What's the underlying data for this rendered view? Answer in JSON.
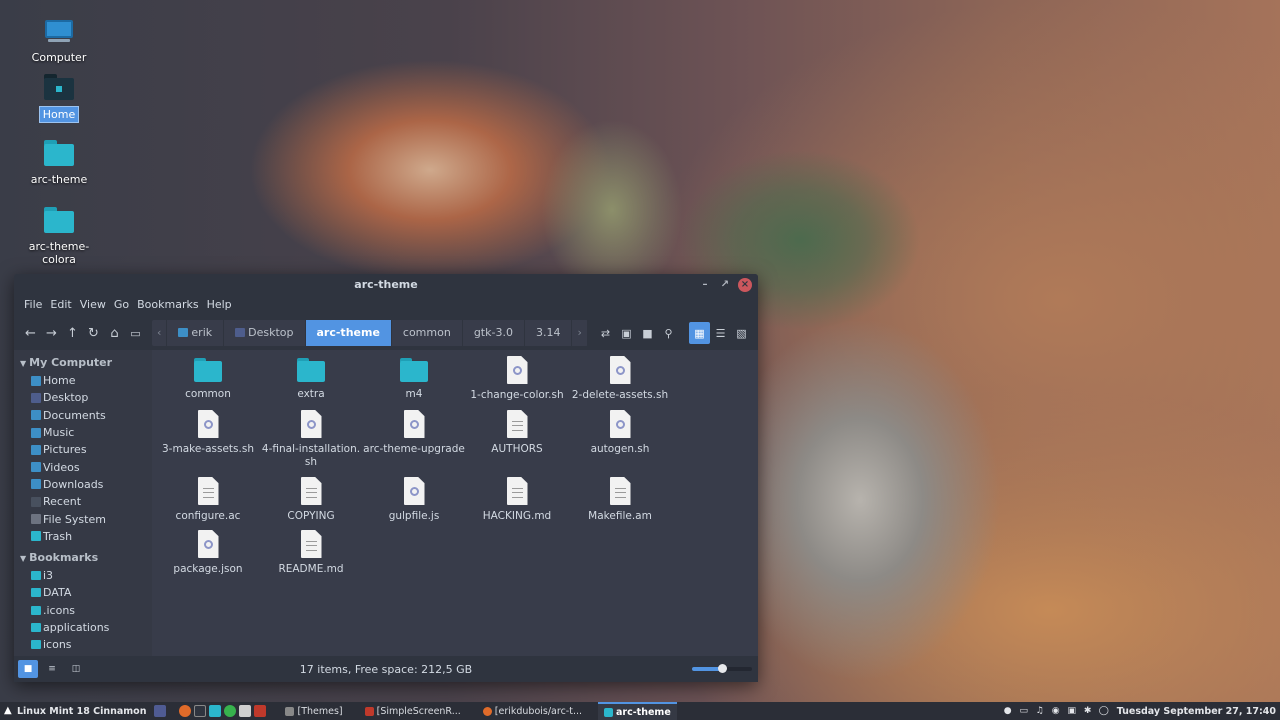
{
  "desktop": {
    "icons": [
      {
        "label": "Computer"
      },
      {
        "label": "Home"
      },
      {
        "label": "arc-theme"
      },
      {
        "label": "arc-theme-colora"
      }
    ]
  },
  "window": {
    "title": "arc-theme",
    "menu": [
      "File",
      "Edit",
      "View",
      "Go",
      "Bookmarks",
      "Help"
    ],
    "breadcrumbs": [
      "erik",
      "Desktop",
      "arc-theme",
      "common",
      "gtk-3.0",
      "3.14"
    ],
    "active_crumb": "arc-theme"
  },
  "sidebar": {
    "my_computer": {
      "title": "My Computer",
      "items": [
        {
          "label": "Home",
          "icon": "home-icon"
        },
        {
          "label": "Desktop",
          "icon": "desktop-icon"
        },
        {
          "label": "Documents",
          "icon": "folder-icon"
        },
        {
          "label": "Music",
          "icon": "music-icon"
        },
        {
          "label": "Pictures",
          "icon": "pictures-icon"
        },
        {
          "label": "Videos",
          "icon": "videos-icon"
        },
        {
          "label": "Downloads",
          "icon": "downloads-icon"
        },
        {
          "label": "Recent",
          "icon": "recent-icon"
        },
        {
          "label": "File System",
          "icon": "filesystem-icon"
        },
        {
          "label": "Trash",
          "icon": "trash-icon"
        }
      ]
    },
    "bookmarks": {
      "title": "Bookmarks",
      "items": [
        {
          "label": "i3"
        },
        {
          "label": "DATA"
        },
        {
          "label": ".icons"
        },
        {
          "label": "applications"
        },
        {
          "label": "icons"
        }
      ]
    }
  },
  "files": [
    {
      "name": "common",
      "type": "folder"
    },
    {
      "name": "extra",
      "type": "folder"
    },
    {
      "name": "m4",
      "type": "folder"
    },
    {
      "name": "1-change-color.sh",
      "type": "script"
    },
    {
      "name": "2-delete-assets.sh",
      "type": "script"
    },
    {
      "name": "3-make-assets.sh",
      "type": "script"
    },
    {
      "name": "4-final-installation.sh",
      "type": "script",
      "line1": "4-final-installation.",
      "line2": "sh"
    },
    {
      "name": "arc-theme-upgrade",
      "type": "script"
    },
    {
      "name": "AUTHORS",
      "type": "text"
    },
    {
      "name": "autogen.sh",
      "type": "script"
    },
    {
      "name": "configure.ac",
      "type": "text"
    },
    {
      "name": "COPYING",
      "type": "text"
    },
    {
      "name": "gulpfile.js",
      "type": "script"
    },
    {
      "name": "HACKING.md",
      "type": "text"
    },
    {
      "name": "Makefile.am",
      "type": "text"
    },
    {
      "name": "package.json",
      "type": "script"
    },
    {
      "name": "README.md",
      "type": "text"
    }
  ],
  "status": {
    "text": "17 items, Free space: 212,5 GB",
    "zoom_fraction": 0.5
  },
  "taskbar": {
    "menu_label": "Linux Mint 18 Cinnamon",
    "windows": [
      {
        "label": "[Themes]",
        "active": false
      },
      {
        "label": "[SimpleScreenR...",
        "active": false
      },
      {
        "label": "[erikdubois/arc-t...",
        "active": false
      },
      {
        "label": "arc-theme",
        "active": true
      }
    ],
    "clock": "Tuesday September 27, 17:40"
  },
  "colors": {
    "accent": "#5294e2",
    "folder": "#2bb6cc",
    "window_bg": "#383c4a",
    "header_bg": "#2f343f",
    "close": "#cc575d"
  }
}
